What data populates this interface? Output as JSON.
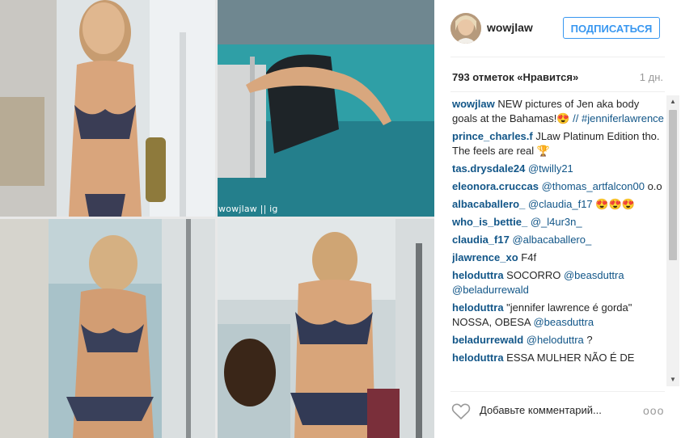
{
  "photo": {
    "watermark": "wowjlaw || ig"
  },
  "header": {
    "username": "wowjlaw",
    "follow_label": "ПОДПИСАТЬСЯ"
  },
  "stats": {
    "likes": "793 отметок «Нравится»",
    "time": "1 дн."
  },
  "comments": [
    {
      "user": "wowjlaw",
      "text": " NEW pictures of Jen aka body goals at the Bahamas!😍 ",
      "mention": "// #jenniferlawrence"
    },
    {
      "user": "prince_charles.f",
      "text": " JLaw Platinum Edition tho. The feels are real 🏆",
      "mention": ""
    },
    {
      "user": "tas.drysdale24",
      "text": " ",
      "mention": "@twilly21"
    },
    {
      "user": "eleonora.cruccas",
      "text": " ",
      "mention": "@thomas_artfalcon00",
      "tail": " o.o"
    },
    {
      "user": "albacaballero_",
      "text": " ",
      "mention": "@claudia_f17",
      "tail": " 😍😍😍"
    },
    {
      "user": "who_is_bettie_",
      "text": " ",
      "mention": "@_l4ur3n_"
    },
    {
      "user": "claudia_f17",
      "text": " ",
      "mention": "@albacaballero_"
    },
    {
      "user": "jlawrence_xo",
      "text": " F4f",
      "mention": ""
    },
    {
      "user": "heloduttra",
      "text": " SOCORRO ",
      "mention": "@beasduttra @beladurrewald"
    },
    {
      "user": "heloduttra",
      "text": " \"jennifer lawrence é gorda\" NOSSA, OBESA ",
      "mention": "@beasduttra"
    },
    {
      "user": "beladurrewald",
      "text": " ",
      "mention": "@heloduttra",
      "tail": " ?"
    },
    {
      "user": "heloduttra",
      "text": " ESSA MULHER NÃO É DE",
      "mention": ""
    }
  ],
  "footer": {
    "add_comment": "Добавьте комментарий...",
    "more": "ooo"
  },
  "icons": {
    "heart": "heart-icon",
    "more": "more-options-icon"
  },
  "colors": {
    "accent": "#3897f0",
    "username_link": "#125688"
  }
}
